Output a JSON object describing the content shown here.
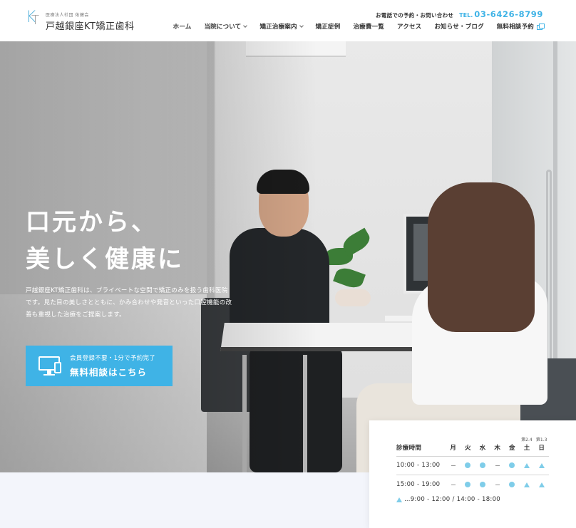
{
  "header": {
    "logo": {
      "mark": [
        "K",
        "T"
      ],
      "subtitle": "医療法人社団 佑健会",
      "name": "戸越銀座KT矯正歯科"
    },
    "contact": {
      "label": "お電話での予約・お問い合わせ",
      "tel_prefix": "TEL.",
      "tel_number": "03-6426-8799"
    },
    "nav": [
      {
        "label": "ホーム"
      },
      {
        "label": "当院について"
      },
      {
        "label": "矯正治療案内"
      },
      {
        "label": "矯正症例"
      },
      {
        "label": "治療費一覧"
      },
      {
        "label": "アクセス"
      },
      {
        "label": "お知らせ・ブログ"
      },
      {
        "label": "無料相談予約"
      }
    ]
  },
  "hero": {
    "title_line1": "口元から、",
    "title_line2": "美しく健康に",
    "description": "戸越銀座KT矯正歯科は、プライベートな空間で矯正のみを扱う歯科医院です。見た目の美しさとともに、かみ合わせや発音といった口腔機能の改善も重視した治療をご提案します。",
    "cta": {
      "small": "会員登録不要・1分で予約完了",
      "big": "無料相談はこちら"
    }
  },
  "hours": {
    "header_label": "診療時間",
    "days": [
      "月",
      "火",
      "水",
      "木",
      "金",
      "土",
      "日"
    ],
    "day_notes": [
      "",
      "",
      "",
      "",
      "",
      "第2.4",
      "第1.3"
    ],
    "rows": [
      {
        "time": "10:00 - 13:00",
        "marks": [
          "dash",
          "dot",
          "dot",
          "dash",
          "dot",
          "tri",
          "tri"
        ]
      },
      {
        "time": "15:00 - 19:00",
        "marks": [
          "dash",
          "dot",
          "dot",
          "dash",
          "dot",
          "tri",
          "tri"
        ]
      }
    ],
    "note": "…9:00 - 12:00 / 14:00 - 18:00",
    "colors": {
      "mark": "#7fcde9",
      "accent": "#3fb3e6"
    }
  }
}
